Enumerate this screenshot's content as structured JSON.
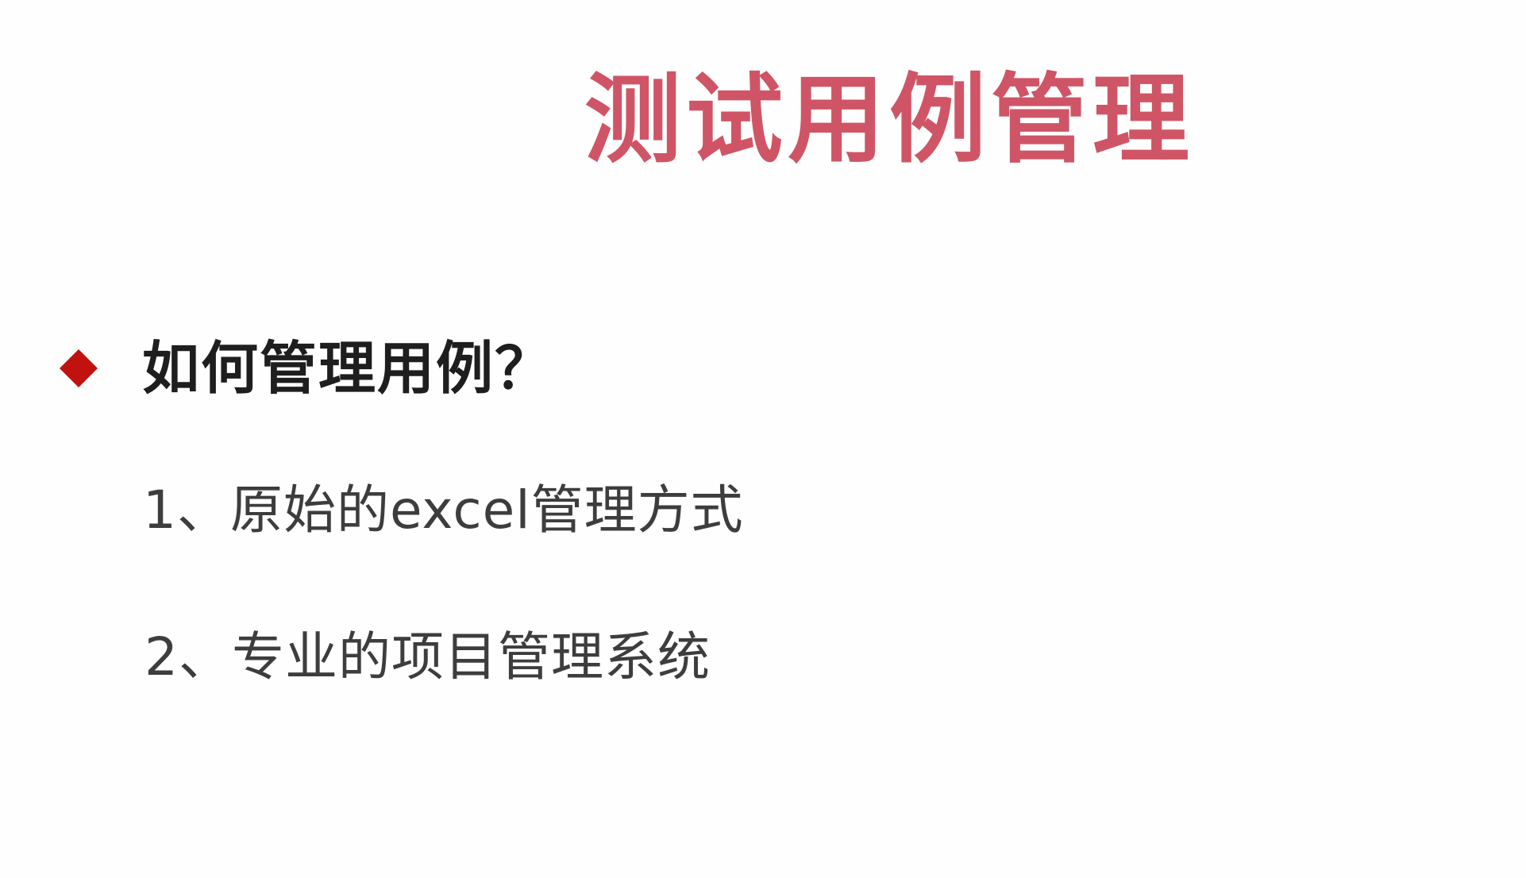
{
  "slide": {
    "title": "测试用例管理",
    "accent_color": "#cf5566",
    "bullet": {
      "icon": "diamond-bullet-icon",
      "icon_color": "#c0130f",
      "text": "如何管理用例？"
    },
    "items": [
      "1、原始的excel管理方式",
      "2、专业的项目管理系统"
    ]
  }
}
